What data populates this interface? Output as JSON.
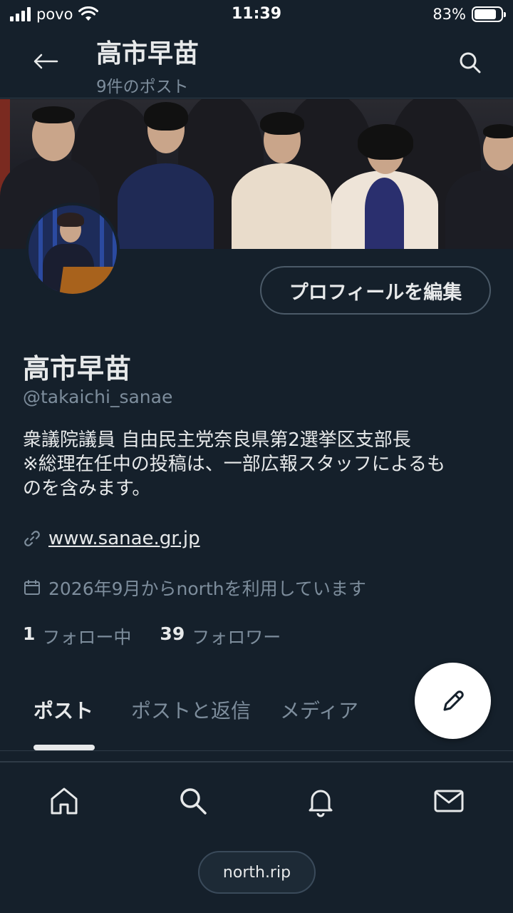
{
  "status_bar": {
    "carrier": "povo",
    "time": "11:39",
    "battery": "83%",
    "battery_level": 0.83
  },
  "header": {
    "title": "高市早苗",
    "subtitle": "9件のポスト"
  },
  "profile": {
    "edit_button": "プロフィールを編集",
    "name": "高市早苗",
    "handle": "@takaichi_sanae",
    "bio_line1": "衆議院議員 自由民主党奈良県第2選挙区支部長",
    "bio_line2": "※総理在任中の投稿は、一部広報スタッフによるも",
    "bio_line3": "のを含みます。",
    "website": "www.sanae.gr.jp",
    "joined": "2026年9月からnorthを利用しています",
    "following_count": "1",
    "following_label": "フォロー中",
    "followers_count": "39",
    "followers_label": "フォロワー"
  },
  "tabs": [
    {
      "label": "ポスト",
      "active": true
    },
    {
      "label": "ポストと返信",
      "active": false
    },
    {
      "label": "メディア",
      "active": false
    }
  ],
  "bottom_nav": {
    "items": [
      "home-icon",
      "search-icon",
      "bell-icon",
      "mail-icon"
    ],
    "url": "north.rip"
  }
}
